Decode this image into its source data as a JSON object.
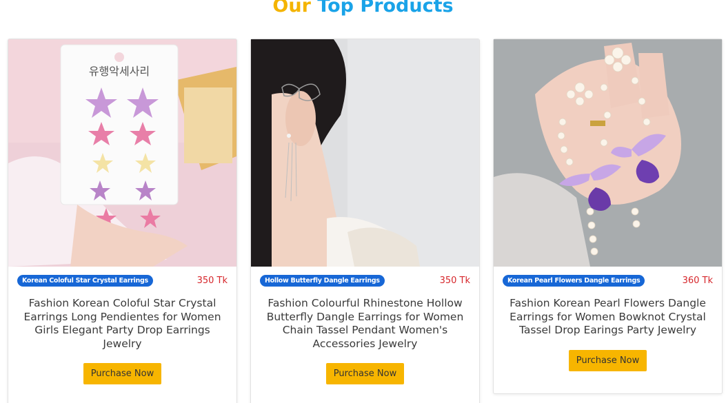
{
  "section": {
    "title_part1": "Our",
    "title_part2": "Top Products"
  },
  "products": [
    {
      "badge": "Korean Coloful Star Crystal Earrings",
      "price": "350 Tk",
      "title": "Fashion Korean Coloful Star Crystal Earrings Long Pendientes for Women Girls Elegant Party Drop Earrings Jewelry",
      "button": "Purchase Now",
      "card_text": "유행악세사리"
    },
    {
      "badge": "Hollow Butterfly Dangle Earrings",
      "price": "350 Tk",
      "title": "Fashion Colourful Rhinestone Hollow Butterfly Dangle Earrings for Women Chain Tassel Pendant Women's Accessories Jewelry",
      "button": "Purchase Now"
    },
    {
      "badge": "Korean Pearl Flowers Dangle Earrings",
      "price": "360 Tk",
      "title": "Fashion Korean Pearl Flowers Dangle Earrings for Women Bowknot Crystal Tassel Drop Earings Party Jewelry",
      "button": "Purchase Now"
    }
  ],
  "colors": {
    "accent_yellow": "#f4b400",
    "accent_blue": "#1aa3e8",
    "badge_blue": "#1767d6",
    "price_red": "#d6262b",
    "button_yellow": "#f7b500"
  }
}
